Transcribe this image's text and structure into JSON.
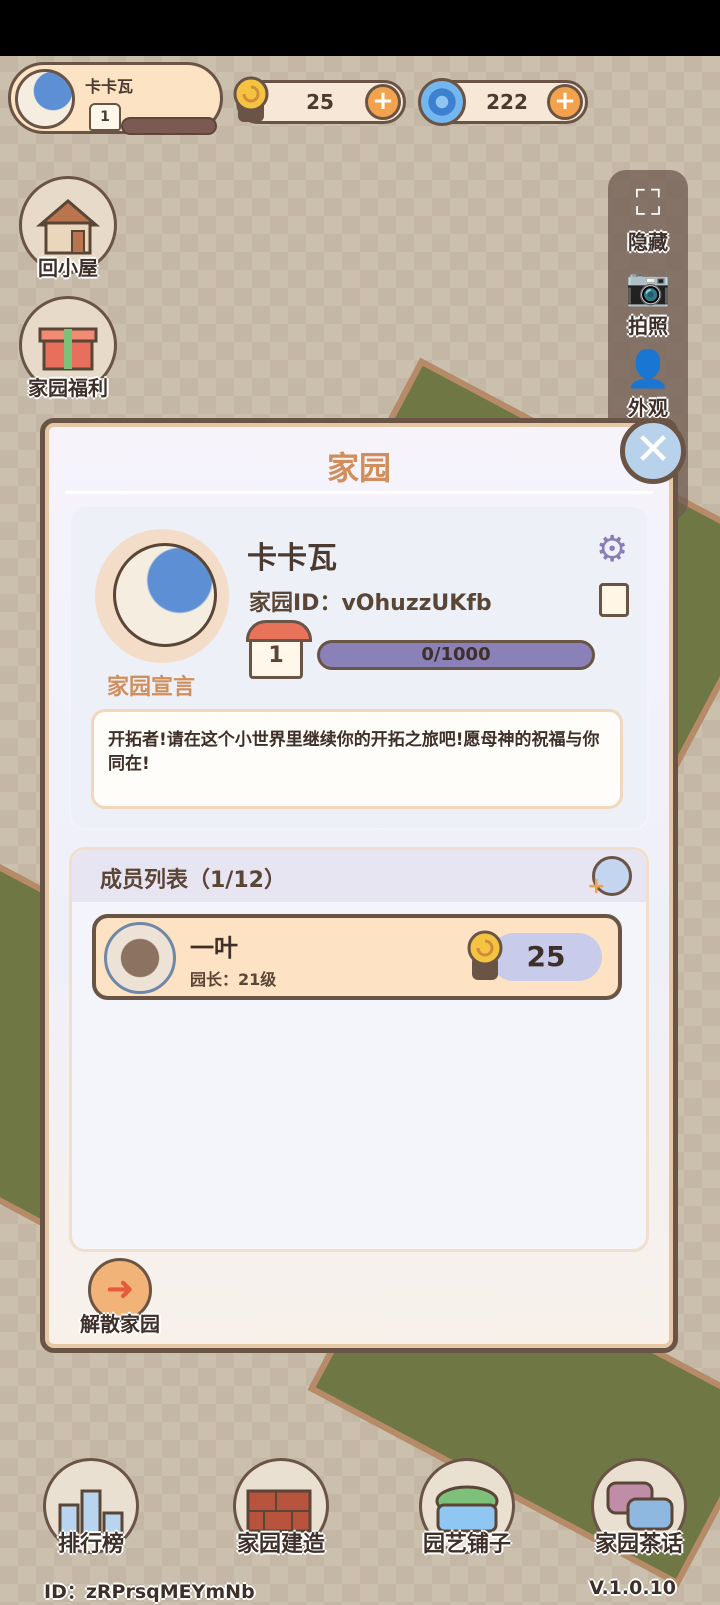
{
  "profile": {
    "name": "卡卡瓦",
    "level": "1"
  },
  "currency": {
    "snail_value": "25",
    "swirl_value": "222",
    "plus": "+"
  },
  "side_left": {
    "home": "回小屋",
    "welfare": "家园福利"
  },
  "side_right": {
    "hide": "隐藏",
    "photo": "拍照",
    "appearance": "外观"
  },
  "dialog": {
    "title": "家园",
    "close": "✕",
    "home_name": "卡卡瓦",
    "home_id": "家园ID：vOhuzzUKfb",
    "level": "1",
    "exp": "0/1000",
    "manifesto_label": "家园宣言",
    "manifesto_text": "开拓者!请在这个小世界里继续你的开拓之旅吧!愿母神的祝福与你同在!",
    "members_title": "成员列表（1/12）",
    "members": [
      {
        "name": "一叶",
        "role": "园长：21级",
        "score": "25"
      }
    ],
    "disband": "解散家园"
  },
  "nav": {
    "ranking": "排行榜",
    "build": "家园建造",
    "gardening": "园艺铺子",
    "chat": "家园茶话"
  },
  "footer": {
    "id": "ID：zRPrsqMEYmNb",
    "version": "V.1.0.10"
  }
}
